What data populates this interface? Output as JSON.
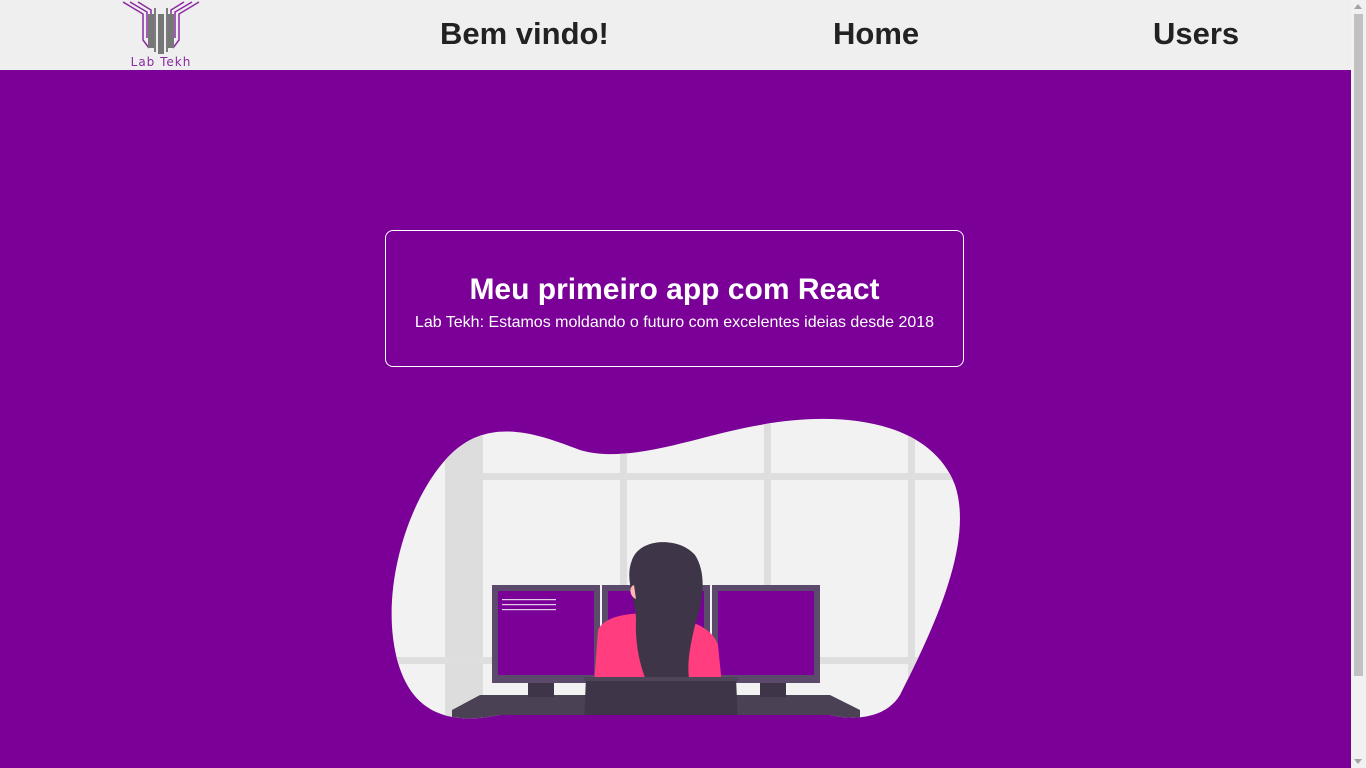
{
  "header": {
    "logo_text": "Lab Tekh",
    "logo_icon": "lab-tekh-logo",
    "nav": {
      "welcome": "Bem vindo!",
      "home": "Home",
      "users": "Users"
    }
  },
  "hero": {
    "title": "Meu primeiro app com React",
    "subtitle": "Lab Tekh: Estamos moldando o futuro com excelentes ideias desde 2018"
  },
  "illustration": {
    "name": "woman-at-computers-illustration"
  },
  "colors": {
    "background": "#7a0098",
    "header_bg": "#efefef",
    "nav_text": "#222222",
    "accent_pink": "#ff3d7f",
    "monitor_frame": "#5b4a6b"
  }
}
